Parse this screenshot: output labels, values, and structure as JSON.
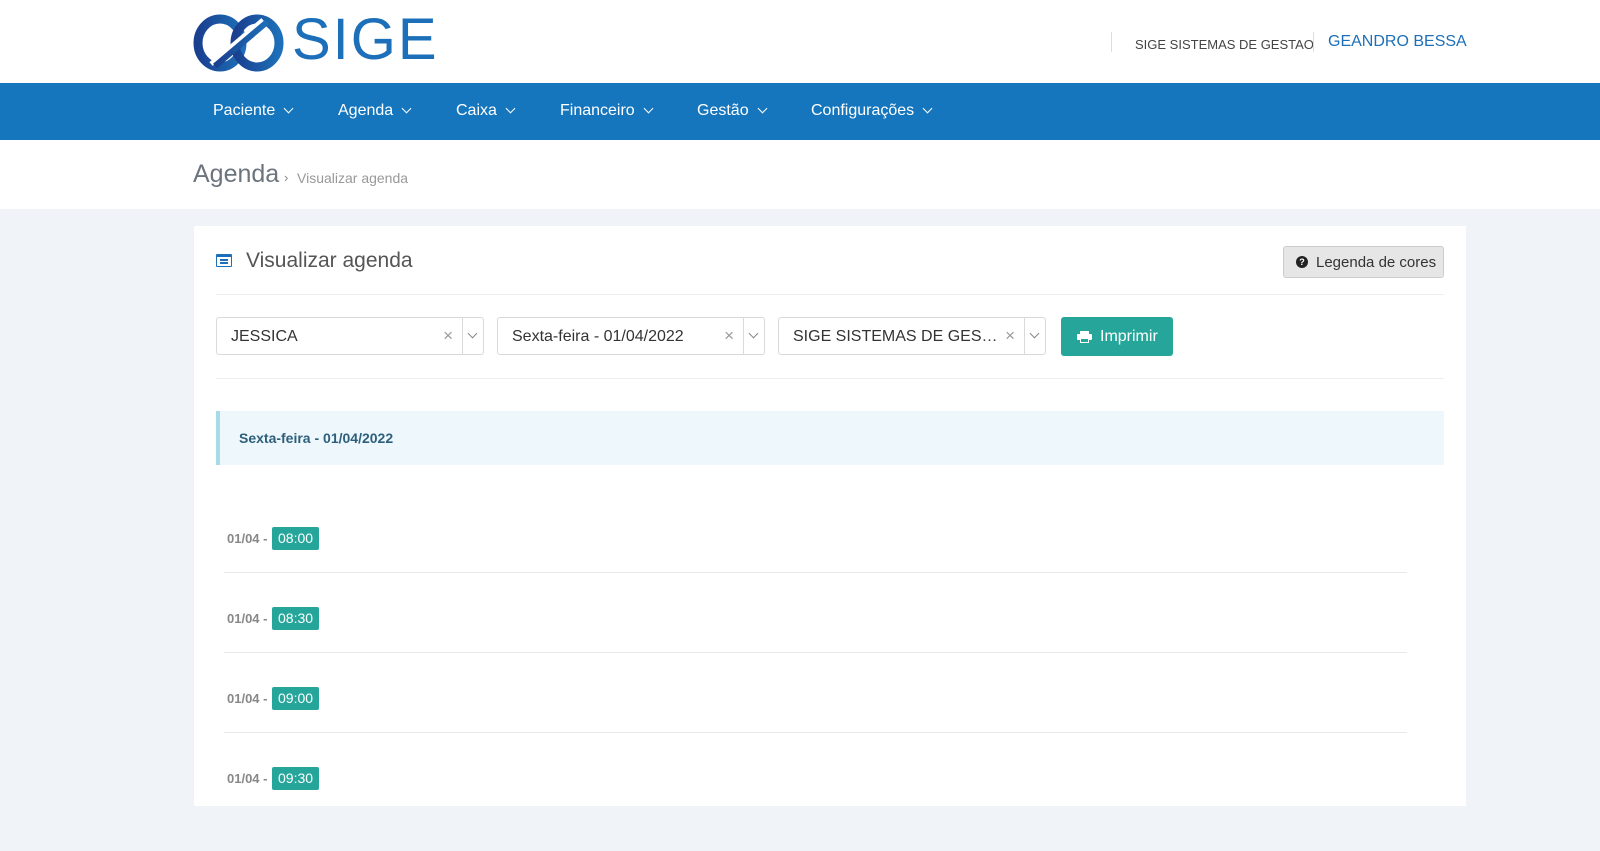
{
  "header": {
    "logo_text": "SIGE",
    "company": "SIGE SISTEMAS DE GESTAO",
    "user": "GEANDRO BESSA"
  },
  "nav": {
    "items": [
      "Paciente",
      "Agenda",
      "Caixa",
      "Financeiro",
      "Gestão",
      "Configurações"
    ]
  },
  "breadcrumb": {
    "title": "Agenda",
    "separator": "›",
    "current": "Visualizar agenda"
  },
  "card": {
    "icon": "calendar-list-icon",
    "title": "Visualizar agenda",
    "legend_button": "Legenda de cores",
    "legend_icon": "question-circle-icon"
  },
  "filters": {
    "professional": "JESSICA",
    "date": "Sexta-feira - 01/04/2022",
    "company": "SIGE SISTEMAS DE GES…",
    "clear_symbol": "×",
    "print_label": "Imprimir",
    "print_icon": "printer-icon"
  },
  "schedule": {
    "day_header": "Sexta-feira - 01/04/2022",
    "slots": [
      {
        "date": "01/04 -",
        "time": "08:00"
      },
      {
        "date": "01/04 -",
        "time": "08:30"
      },
      {
        "date": "01/04 -",
        "time": "09:00"
      },
      {
        "date": "01/04 -",
        "time": "09:30"
      }
    ]
  },
  "colors": {
    "brand": "#1576bd",
    "accent": "#26a69a",
    "page_bg": "#f0f4f8"
  }
}
